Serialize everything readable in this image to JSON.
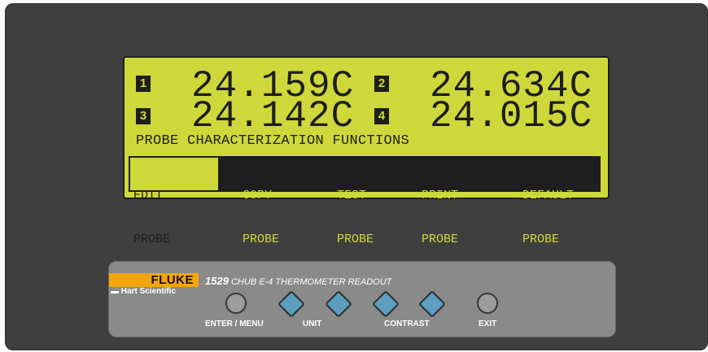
{
  "display": {
    "readings": [
      {
        "channel": "1",
        "value": "24.159C"
      },
      {
        "channel": "2",
        "value": "24.634C"
      },
      {
        "channel": "3",
        "value": "24.142C"
      },
      {
        "channel": "4",
        "value": "24.015C"
      }
    ],
    "menu_title": "PROBE CHARACTERIZATION FUNCTIONS",
    "softkeys": [
      {
        "line1": "EDIT",
        "line2": "PROBE",
        "selected": true
      },
      {
        "line1": "COPY",
        "line2": "PROBE",
        "selected": false
      },
      {
        "line1": "TEST",
        "line2": "PROBE",
        "selected": false
      },
      {
        "line1": "PRINT",
        "line2": "PROBE",
        "selected": false
      },
      {
        "line1": "DEFAULT",
        "line2": "PROBE",
        "selected": false
      }
    ]
  },
  "panel": {
    "brand": "FLUKE",
    "sub_brand": "Hart Scientific",
    "model_number": "1529",
    "model_name": "CHUB E-4 THERMOMETER READOUT",
    "labels": {
      "enter_menu": "ENTER / MENU",
      "unit": "UNIT",
      "contrast": "CONTRAST",
      "exit": "EXIT"
    }
  },
  "colors": {
    "lcd": "#cfd83a",
    "lcd_text": "#1e1e1e",
    "device": "#3f3f3f",
    "panel": "#8a8a8a",
    "fluke_orange": "#f3a50b",
    "arrow_button": "#5c9dc0"
  }
}
